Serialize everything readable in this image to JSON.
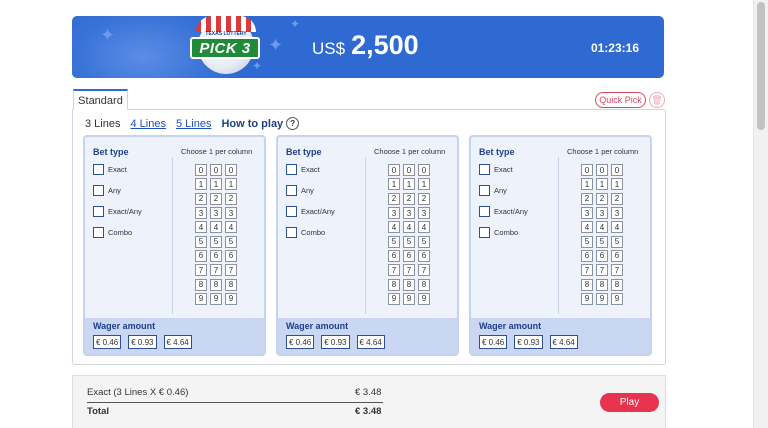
{
  "header": {
    "logo_text": "PICK 3",
    "logo_brand": "TEXAS LOTTERY",
    "currency": "US$",
    "jackpot": "2,500",
    "countdown": "01:23:16",
    "background_color": "#2f6ad3"
  },
  "tabs": {
    "standard": "Standard",
    "quick_pick": "Quick Pick",
    "trash_icon": "trash-icon"
  },
  "lines": {
    "options": [
      "3 Lines",
      "4 Lines",
      "5 Lines"
    ],
    "selected": "3 Lines",
    "how_to_play": "How to play",
    "help_glyph": "?"
  },
  "cards": [
    {
      "bet_type_title": "Bet type",
      "choose_label": "Choose 1 per column",
      "bet_options": [
        "Exact",
        "Any",
        "Exact/Any",
        "Combo"
      ],
      "digit_rows": [
        [
          "0",
          "0",
          "0"
        ],
        [
          "1",
          "1",
          "1"
        ],
        [
          "2",
          "2",
          "2"
        ],
        [
          "3",
          "3",
          "3"
        ],
        [
          "4",
          "4",
          "4"
        ],
        [
          "5",
          "5",
          "5"
        ],
        [
          "6",
          "6",
          "6"
        ],
        [
          "7",
          "7",
          "7"
        ],
        [
          "8",
          "8",
          "8"
        ],
        [
          "9",
          "9",
          "9"
        ]
      ],
      "wager_title": "Wager amount",
      "wager_options": [
        "€ 0.46",
        "€ 0.93",
        "€ 4.64"
      ]
    },
    {
      "bet_type_title": "Bet type",
      "choose_label": "Choose 1 per column",
      "bet_options": [
        "Exact",
        "Any",
        "Exact/Any",
        "Combo"
      ],
      "digit_rows": [
        [
          "0",
          "0",
          "0"
        ],
        [
          "1",
          "1",
          "1"
        ],
        [
          "2",
          "2",
          "2"
        ],
        [
          "3",
          "3",
          "3"
        ],
        [
          "4",
          "4",
          "4"
        ],
        [
          "5",
          "5",
          "5"
        ],
        [
          "6",
          "6",
          "6"
        ],
        [
          "7",
          "7",
          "7"
        ],
        [
          "8",
          "8",
          "8"
        ],
        [
          "9",
          "9",
          "9"
        ]
      ],
      "wager_title": "Wager amount",
      "wager_options": [
        "€ 0.46",
        "€ 0.93",
        "€ 4.64"
      ]
    },
    {
      "bet_type_title": "Bet type",
      "choose_label": "Choose 1 per column",
      "bet_options": [
        "Exact",
        "Any",
        "Exact/Any",
        "Combo"
      ],
      "digit_rows": [
        [
          "0",
          "0",
          "0"
        ],
        [
          "1",
          "1",
          "1"
        ],
        [
          "2",
          "2",
          "2"
        ],
        [
          "3",
          "3",
          "3"
        ],
        [
          "4",
          "4",
          "4"
        ],
        [
          "5",
          "5",
          "5"
        ],
        [
          "6",
          "6",
          "6"
        ],
        [
          "7",
          "7",
          "7"
        ],
        [
          "8",
          "8",
          "8"
        ],
        [
          "9",
          "9",
          "9"
        ]
      ],
      "wager_title": "Wager amount",
      "wager_options": [
        "€ 0.46",
        "€ 0.93",
        "€ 4.64"
      ]
    }
  ],
  "summary": {
    "line_label": "Exact (3 Lines X € 0.46)",
    "line_value": "€ 3.48",
    "total_label": "Total",
    "total_value": "€ 3.48",
    "play_label": "Play",
    "play_color": "#e8334f"
  }
}
